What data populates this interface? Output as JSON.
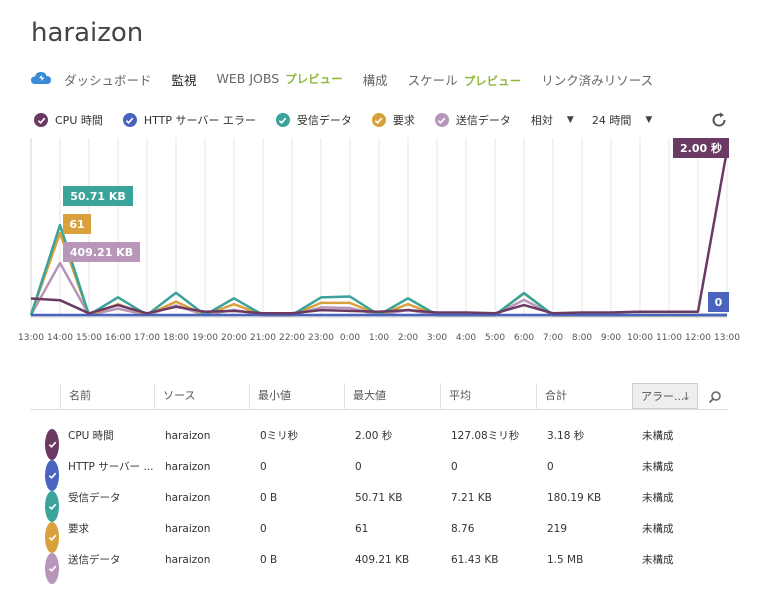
{
  "title": "haraizon",
  "nav": {
    "items": [
      {
        "label": "ダッシュボード",
        "preview": ""
      },
      {
        "label": "監視",
        "preview": ""
      },
      {
        "label": "WEB JOBS",
        "preview": "プレビュー"
      },
      {
        "label": "構成",
        "preview": ""
      },
      {
        "label": "スケール",
        "preview": "プレビュー"
      },
      {
        "label": "リンク済みリソース",
        "preview": ""
      }
    ],
    "active_index": 1
  },
  "legend": [
    {
      "label": "CPU 時間",
      "color": "#6b3a63"
    },
    {
      "label": "HTTP サーバー エラー",
      "color": "#4a63bf"
    },
    {
      "label": "受信データ",
      "color": "#3aa39a"
    },
    {
      "label": "要求",
      "color": "#d9a13b"
    },
    {
      "label": "送信データ",
      "color": "#b796b9"
    }
  ],
  "controls": {
    "mode": "相対",
    "range": "24 時間"
  },
  "chart_data": {
    "type": "line",
    "x": [
      "13:00",
      "14:00",
      "15:00",
      "16:00",
      "17:00",
      "18:00",
      "19:00",
      "20:00",
      "21:00",
      "22:00",
      "23:00",
      "0:00",
      "1:00",
      "2:00",
      "3:00",
      "4:00",
      "5:00",
      "6:00",
      "7:00",
      "8:00",
      "9:00",
      "10:00",
      "11:00",
      "12:00",
      "13:00"
    ],
    "series": [
      {
        "name": "CPU 時間",
        "color": "#6b3a63",
        "values": [
          0.2,
          0.18,
          0.02,
          0.12,
          0.02,
          0.1,
          0.04,
          0.05,
          0.02,
          0.02,
          0.06,
          0.05,
          0.04,
          0.06,
          0.03,
          0.03,
          0.02,
          0.12,
          0.02,
          0.03,
          0.03,
          0.04,
          0.04,
          0.04,
          2.0
        ]
      },
      {
        "name": "HTTP サーバー エラー",
        "color": "#4a63bf",
        "values": [
          0,
          0,
          0,
          0,
          0,
          0,
          0,
          0,
          0,
          0,
          0,
          0,
          0,
          0,
          0,
          0,
          0,
          0,
          0,
          0,
          0,
          0,
          0,
          0,
          0
        ]
      },
      {
        "name": "受信データ",
        "color": "#3aa39a",
        "values": [
          0,
          50.71,
          0,
          10.0,
          0,
          12.5,
          0,
          9.4,
          0,
          0,
          9.9,
          10.4,
          0,
          9.4,
          0,
          0,
          0,
          12.4,
          0,
          0,
          0,
          0,
          0,
          0,
          0
        ]
      },
      {
        "name": "要求",
        "color": "#d9a13b",
        "values": [
          0,
          61,
          0,
          8,
          0,
          10,
          0,
          8,
          0,
          0,
          9,
          9,
          0,
          8,
          0,
          0,
          0,
          16,
          0,
          0,
          0,
          0,
          0,
          0,
          0
        ]
      },
      {
        "name": "送信データ",
        "color": "#b796b9",
        "values": [
          0,
          409.21,
          0,
          50,
          0,
          75,
          0,
          40,
          0,
          0,
          60,
          55,
          0,
          40,
          0,
          0,
          0,
          120,
          0,
          0,
          0,
          0,
          0,
          0,
          0
        ]
      }
    ],
    "tooltips": [
      "50.71 KB",
      "61",
      "409.21 KB",
      "2.00 秒",
      "0"
    ]
  },
  "table": {
    "columns": [
      "名前",
      "ソース",
      "最小値",
      "最大値",
      "平均",
      "合計",
      "アラー..."
    ],
    "rows": [
      {
        "name": "CPU 時間",
        "source": "haraizon",
        "min": "0ミリ秒",
        "max": "2.00 秒",
        "avg": "127.08ミリ秒",
        "sum": "3.18 秒",
        "alert": "未構成"
      },
      {
        "name": "HTTP サーバー ...",
        "source": "haraizon",
        "min": "0",
        "max": "0",
        "avg": "0",
        "sum": "0",
        "alert": "未構成"
      },
      {
        "name": "受信データ",
        "source": "haraizon",
        "min": "0 B",
        "max": "50.71 KB",
        "avg": "7.21 KB",
        "sum": "180.19 KB",
        "alert": "未構成"
      },
      {
        "name": "要求",
        "source": "haraizon",
        "min": "0",
        "max": "61",
        "avg": "8.76",
        "sum": "219",
        "alert": "未構成"
      },
      {
        "name": "送信データ",
        "source": "haraizon",
        "min": "0 B",
        "max": "409.21 KB",
        "avg": "61.43 KB",
        "sum": "1.5 MB",
        "alert": "未構成"
      }
    ]
  }
}
